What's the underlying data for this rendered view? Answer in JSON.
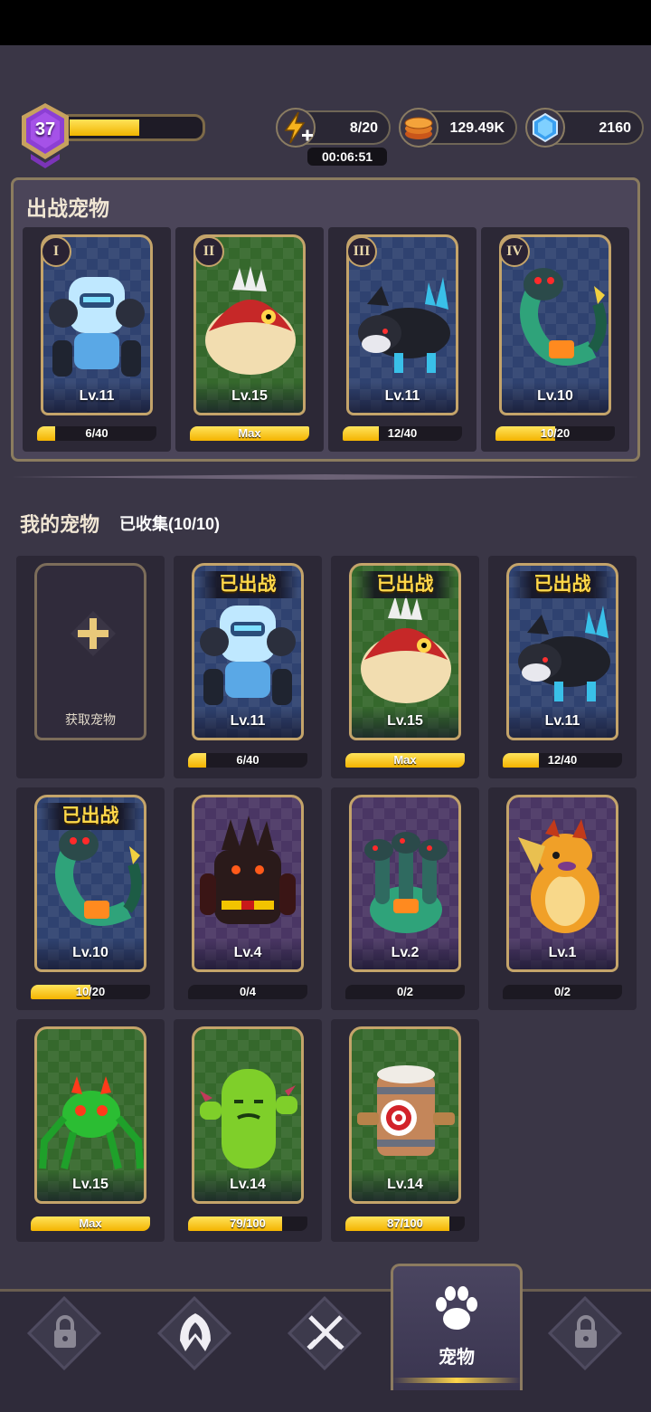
{
  "player": {
    "level": "37",
    "xp_fraction": 0.52
  },
  "resources": {
    "energy": {
      "icon": "lightning-plus-icon",
      "value": "8/20",
      "timer": "00:06:51"
    },
    "coins": {
      "icon": "coin-stack-icon",
      "value": "129.49K"
    },
    "gems": {
      "icon": "blue-gem-icon",
      "value": "2160"
    }
  },
  "battle": {
    "title": "出战宠物",
    "slots": [
      {
        "roman": "I",
        "pet": "blue-golem",
        "bg": "blue",
        "level": "Lv.11",
        "progress": "6/40",
        "fill": 0.15
      },
      {
        "roman": "II",
        "pet": "red-piranha",
        "bg": "green",
        "level": "Lv.15",
        "progress": "Max",
        "fill": 1.0
      },
      {
        "roman": "III",
        "pet": "black-wolf",
        "bg": "blue",
        "level": "Lv.11",
        "progress": "12/40",
        "fill": 0.3
      },
      {
        "roman": "IV",
        "pet": "green-snake",
        "bg": "blue",
        "level": "Lv.10",
        "progress": "10/20",
        "fill": 0.5
      }
    ]
  },
  "my_pets": {
    "title": "我的宠物",
    "collected": "已收集(10/10)",
    "add_label": "获取宠物",
    "deployed_label": "已出战",
    "items": [
      {
        "pet": "blue-golem",
        "bg": "blue",
        "level": "Lv.11",
        "progress": "6/40",
        "fill": 0.15,
        "deployed": true
      },
      {
        "pet": "red-piranha",
        "bg": "green",
        "level": "Lv.15",
        "progress": "Max",
        "fill": 1.0,
        "deployed": true
      },
      {
        "pet": "black-wolf",
        "bg": "blue",
        "level": "Lv.11",
        "progress": "12/40",
        "fill": 0.3,
        "deployed": true
      },
      {
        "pet": "green-snake",
        "bg": "blue",
        "level": "Lv.10",
        "progress": "10/20",
        "fill": 0.5,
        "deployed": true
      },
      {
        "pet": "lava-golem",
        "bg": "purple",
        "level": "Lv.4",
        "progress": "0/4",
        "fill": 0.0,
        "deployed": false
      },
      {
        "pet": "three-headed-hydra",
        "bg": "purple",
        "level": "Lv.2",
        "progress": "0/2",
        "fill": 0.0,
        "deployed": false
      },
      {
        "pet": "orange-dragon",
        "bg": "purple",
        "level": "Lv.1",
        "progress": "0/2",
        "fill": 0.0,
        "deployed": false
      },
      {
        "pet": "green-spider",
        "bg": "green",
        "level": "Lv.15",
        "progress": "Max",
        "fill": 1.0,
        "deployed": false
      },
      {
        "pet": "cactus-monster",
        "bg": "green",
        "level": "Lv.14",
        "progress": "79/100",
        "fill": 0.79,
        "deployed": false
      },
      {
        "pet": "target-barrel",
        "bg": "green",
        "level": "Lv.14",
        "progress": "87/100",
        "fill": 0.87,
        "deployed": false
      }
    ]
  },
  "nav": {
    "items": [
      {
        "icon": "lock-icon",
        "locked": true
      },
      {
        "icon": "hooded-hero-icon",
        "locked": false
      },
      {
        "icon": "crossed-swords-icon",
        "locked": false
      },
      {
        "icon": "paw-icon",
        "label": "宠物",
        "active": true
      },
      {
        "icon": "lock-icon",
        "locked": true
      }
    ]
  }
}
